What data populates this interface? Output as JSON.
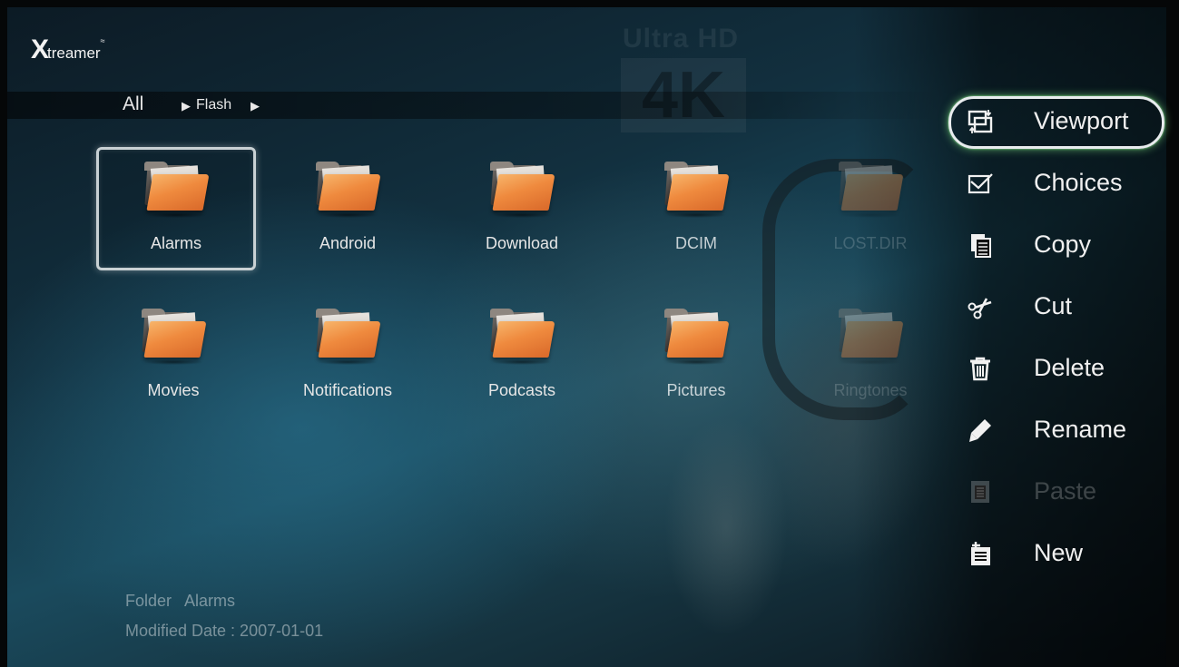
{
  "logo": {
    "x": "X",
    "rest": "treamer",
    "wave": "≈"
  },
  "breadcrumb": {
    "root": "All",
    "arrow": "▶",
    "current": "Flash"
  },
  "background": {
    "badge_top": "Ultra HD",
    "badge_main": "4K"
  },
  "folders": [
    {
      "name": "Alarms",
      "state": "selected"
    },
    {
      "name": "Android",
      "state": "normal"
    },
    {
      "name": "Download",
      "state": "normal"
    },
    {
      "name": "DCIM",
      "state": "half"
    },
    {
      "name": "LOST.DIR",
      "state": "dim"
    },
    {
      "name": "Movies",
      "state": "normal"
    },
    {
      "name": "Notifications",
      "state": "normal"
    },
    {
      "name": "Podcasts",
      "state": "normal"
    },
    {
      "name": "Pictures",
      "state": "half"
    },
    {
      "name": "Ringtones",
      "state": "dim"
    }
  ],
  "info": {
    "type_line": "Folder   Alarms",
    "date_line": "Modified Date : 2007-01-01"
  },
  "menu": [
    {
      "label": "Viewport",
      "icon": "viewport-icon",
      "selected": true,
      "enabled": true
    },
    {
      "label": "Choices",
      "icon": "checkbox-icon",
      "selected": false,
      "enabled": true
    },
    {
      "label": "Copy",
      "icon": "copy-icon",
      "selected": false,
      "enabled": true
    },
    {
      "label": "Cut",
      "icon": "scissors-icon",
      "selected": false,
      "enabled": true
    },
    {
      "label": "Delete",
      "icon": "trash-icon",
      "selected": false,
      "enabled": true
    },
    {
      "label": "Rename",
      "icon": "pencil-icon",
      "selected": false,
      "enabled": true
    },
    {
      "label": "Paste",
      "icon": "paste-icon",
      "selected": false,
      "enabled": false
    },
    {
      "label": "New",
      "icon": "new-document-icon",
      "selected": false,
      "enabled": true
    }
  ],
  "colors": {
    "selection_glow": "#8cff8c",
    "folder_orange": "#ef8a3e",
    "text": "#f0f0f0"
  }
}
